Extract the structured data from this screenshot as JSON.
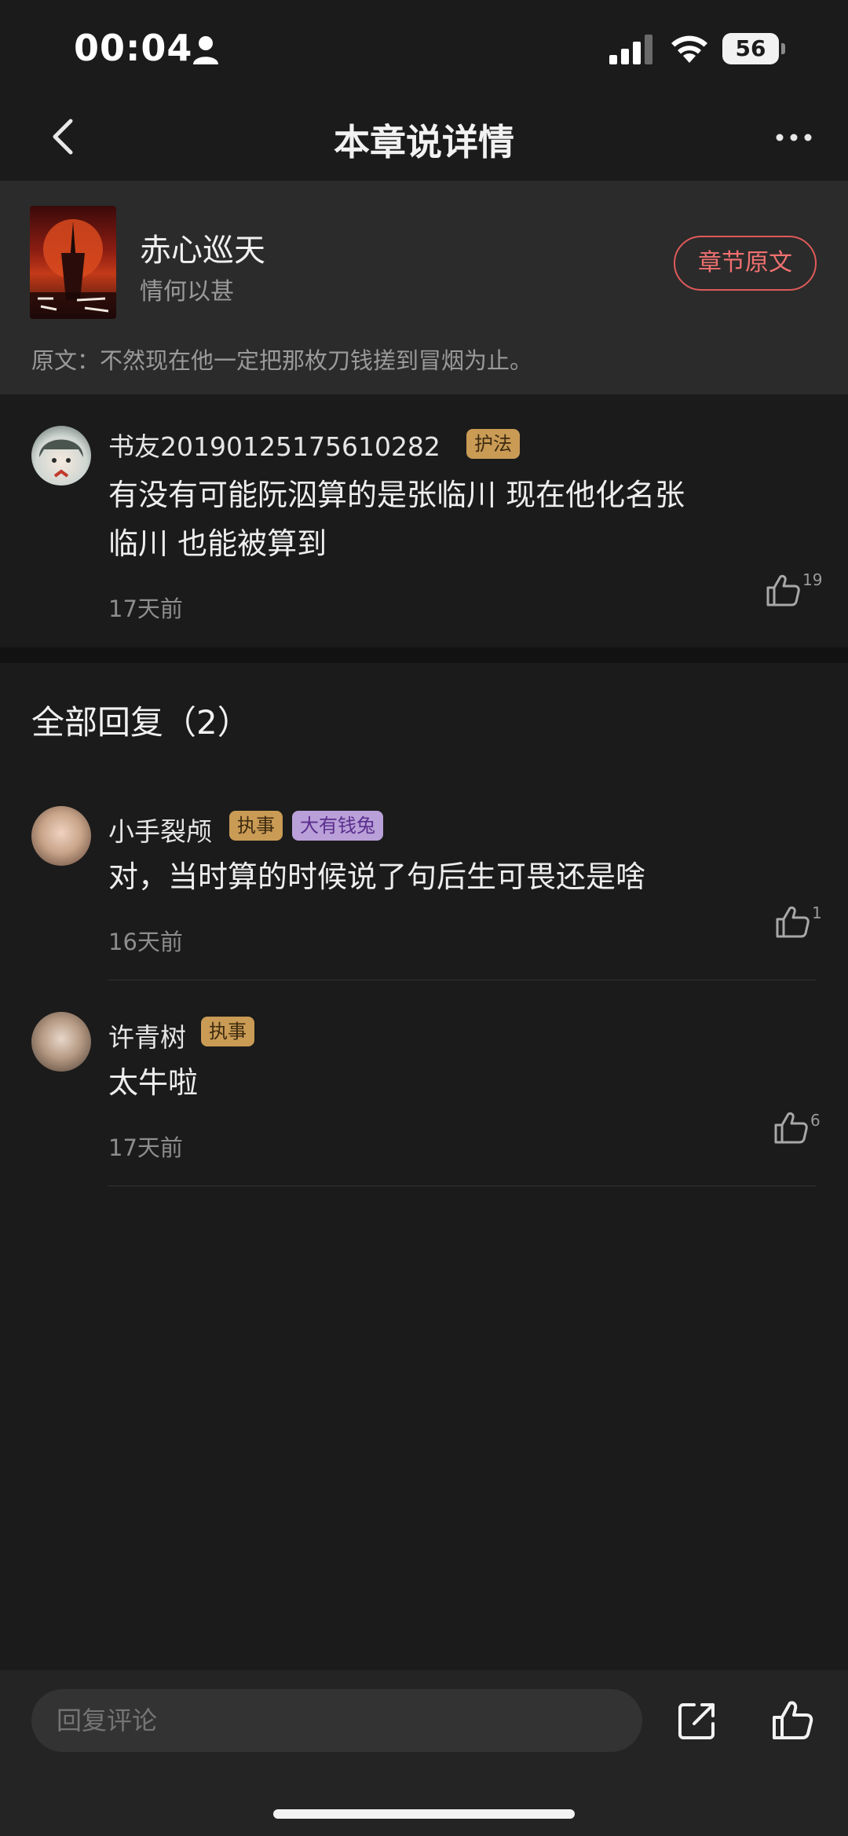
{
  "status_bar": {
    "time": "00:04",
    "battery": "56"
  },
  "nav": {
    "title": "本章说详情"
  },
  "book": {
    "title": "赤心巡天",
    "author": "情何以甚",
    "chapter_button": "章节原文",
    "quote": "原文：不然现在他一定把那枚刀钱搓到冒烟为止。"
  },
  "main_comment": {
    "username": "书友20190125175610282",
    "badge": "护法",
    "text_line1": "有没有可能阮泅算的是张临川 现在他化名张",
    "text_line2": "临川 也能被算到",
    "time": "17天前",
    "likes": "19"
  },
  "replies_title": "全部回复（2）",
  "replies": [
    {
      "username": "小手裂颅",
      "badges": [
        "执事",
        "大有钱兔"
      ],
      "text": "对，当时算的时候说了句后生可畏还是啥",
      "time": "16天前",
      "likes": "1"
    },
    {
      "username": "许青树",
      "badges": [
        "执事"
      ],
      "text": "太牛啦",
      "time": "17天前",
      "likes": "6"
    }
  ],
  "bottom_bar": {
    "reply_placeholder": "回复评论"
  },
  "colors": {
    "background": "#1b1b1b",
    "card": "#2b2b2b",
    "accent_red": "#f07070",
    "badge_gold": "#c99b55",
    "badge_purple": "#b9a0d8"
  },
  "icons": [
    "person-icon",
    "signal-icon",
    "wifi-icon",
    "back-icon",
    "more-icon",
    "thumbs-up-icon",
    "share-icon"
  ]
}
